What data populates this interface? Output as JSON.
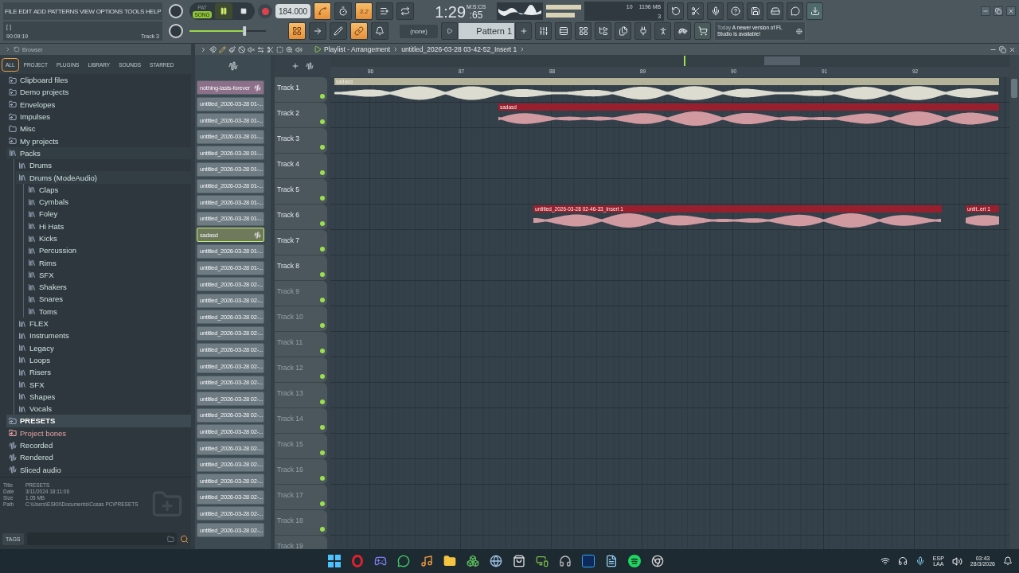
{
  "menu": [
    "FILE",
    "EDIT",
    "ADD",
    "PATTERNS",
    "VIEW",
    "OPTIONS",
    "TOOLS",
    "HELP"
  ],
  "hint": {
    "bracket": "[ ]",
    "time": "90:09:19",
    "track": "Track 3"
  },
  "transport": {
    "modes": [
      {
        "label": "PAT",
        "selected": false
      },
      {
        "label": "SONG",
        "selected": true
      }
    ]
  },
  "tempo": "184.000",
  "master_volume": {
    "level": 0.73
  },
  "time": {
    "main": "1:29",
    "fraction": ":65",
    "unit": "M:S:CS"
  },
  "cpu": {
    "count": "10",
    "memory": "1196 MB",
    "count_2": "3"
  },
  "toggles_top": [
    {
      "kind": "metronome",
      "on": true
    },
    {
      "kind": "wait",
      "on": false
    },
    {
      "kind": "countdown",
      "on": true,
      "label": "3.2"
    },
    {
      "kind": "overdub",
      "on": false
    },
    {
      "kind": "loop",
      "on": false
    }
  ],
  "toggles_bottom": [
    {
      "kind": "step",
      "on": true
    },
    {
      "kind": "arrow",
      "on": false
    },
    {
      "kind": "blend",
      "on": false
    },
    {
      "kind": "link",
      "on": true
    },
    {
      "kind": "bell",
      "on": false
    }
  ],
  "pattern_selector": {
    "value": "(none)",
    "pattern": "Pattern 1"
  },
  "news": {
    "date": "Today",
    "message": "A newer version of FL Studio is available!"
  },
  "browser": {
    "title": "Browser",
    "tabs": [
      {
        "label": "ALL",
        "selected": true
      },
      {
        "label": "PROJECT",
        "selected": false
      },
      {
        "label": "PLUGINS",
        "selected": false
      },
      {
        "label": "LIBRARY",
        "selected": false
      },
      {
        "label": "SOUNDS",
        "selected": false
      },
      {
        "label": "STARRED",
        "selected": false
      }
    ],
    "tree": [
      {
        "label": "Clipboard files",
        "kind": "link_folder",
        "selected": false
      },
      {
        "label": "Demo projects",
        "kind": "link_folder",
        "selected": false
      },
      {
        "label": "Envelopes",
        "kind": "link_folder",
        "selected": false
      },
      {
        "label": "Impulses",
        "kind": "link_folder",
        "selected": false
      },
      {
        "label": "Misc",
        "kind": "folder",
        "selected": false
      },
      {
        "label": "My projects",
        "kind": "link_folder",
        "selected": false
      },
      {
        "label": "Packs",
        "kind": "pack",
        "selected": false,
        "expanded": true,
        "children": [
          {
            "label": "Drums",
            "kind": "pack",
            "selected": false
          },
          {
            "label": "Drums (ModeAudio)",
            "kind": "pack",
            "selected": false,
            "expanded": true,
            "children": [
              {
                "label": "Claps",
                "kind": "pack",
                "selected": false
              },
              {
                "label": "Cymbals",
                "kind": "pack",
                "selected": false
              },
              {
                "label": "Foley",
                "kind": "pack",
                "selected": false
              },
              {
                "label": "Hi Hats",
                "kind": "pack",
                "selected": false
              },
              {
                "label": "Kicks",
                "kind": "pack",
                "selected": false
              },
              {
                "label": "Percussion",
                "kind": "pack",
                "selected": false
              },
              {
                "label": "Rims",
                "kind": "pack",
                "selected": false
              },
              {
                "label": "SFX",
                "kind": "pack",
                "selected": false
              },
              {
                "label": "Shakers",
                "kind": "pack",
                "selected": false
              },
              {
                "label": "Snares",
                "kind": "pack",
                "selected": false
              },
              {
                "label": "Toms",
                "kind": "pack",
                "selected": false
              }
            ]
          },
          {
            "label": "FLEX",
            "kind": "pack",
            "selected": false
          },
          {
            "label": "Instruments",
            "kind": "pack",
            "selected": false
          },
          {
            "label": "Legacy",
            "kind": "pack",
            "selected": false
          },
          {
            "label": "Loops",
            "kind": "pack",
            "selected": false
          },
          {
            "label": "Risers",
            "kind": "pack",
            "selected": false
          },
          {
            "label": "SFX",
            "kind": "pack",
            "selected": false
          },
          {
            "label": "Shapes",
            "kind": "pack",
            "selected": false
          },
          {
            "label": "Vocals",
            "kind": "pack",
            "selected": false
          }
        ]
      },
      {
        "label": "PRESETS",
        "kind": "link_folder",
        "selected": true
      },
      {
        "label": "Project bones",
        "kind": "link_folder",
        "selected": false,
        "color": "#e6a3a3"
      },
      {
        "label": "Recorded",
        "kind": "audio",
        "selected": false
      },
      {
        "label": "Rendered",
        "kind": "audio",
        "selected": false
      },
      {
        "label": "Sliced audio",
        "kind": "audio",
        "selected": false
      }
    ],
    "info": [
      {
        "label": "Title",
        "value": "PRESETS"
      },
      {
        "label": "Date",
        "value": "3/11/2024 18:11:06"
      },
      {
        "label": "Size",
        "value": "1.05 MB"
      },
      {
        "label": "Path",
        "value": "C:\\Users\\ESKII\\Documents\\Cosas PC\\PRESETS"
      }
    ],
    "tags": "TAGS"
  },
  "playlist": {
    "title": "Playlist - Arrangement",
    "clip_name": "untitled_2026-03-28 03-42-52_Insert 1",
    "ruler": [
      "86",
      "87",
      "88",
      "89",
      "90",
      "91",
      "92"
    ],
    "tracks": [
      {
        "name": "Track 1",
        "dimmed": false,
        "on": true,
        "clips": [
          {
            "label": "sadasd",
            "color": "#b4b299"
          }
        ]
      },
      {
        "name": "Track 2",
        "dimmed": false,
        "on": true,
        "clips": [
          {
            "label": "sadasd",
            "color": "#981f2d"
          }
        ]
      },
      {
        "name": "Track 3",
        "dimmed": false,
        "on": true
      },
      {
        "name": "Track 4",
        "dimmed": false,
        "on": true
      },
      {
        "name": "Track 5",
        "dimmed": false,
        "on": true
      },
      {
        "name": "Track 6",
        "dimmed": false,
        "on": true,
        "clips": [
          {
            "label": "untitled_2026-03-28 02-46-33_Insert 1",
            "color": "#981f2d"
          },
          {
            "label": "untit..ert 1",
            "color": "#981f2d"
          }
        ]
      },
      {
        "name": "Track 7",
        "dimmed": false,
        "on": true
      },
      {
        "name": "Track 8",
        "dimmed": false,
        "on": true
      },
      {
        "name": "Track 9",
        "dimmed": true,
        "on": true
      },
      {
        "name": "Track 10",
        "dimmed": true,
        "on": true
      },
      {
        "name": "Track 11",
        "dimmed": true,
        "on": true
      },
      {
        "name": "Track 12",
        "dimmed": true,
        "on": true
      },
      {
        "name": "Track 13",
        "dimmed": true,
        "on": true
      },
      {
        "name": "Track 14",
        "dimmed": true,
        "on": true
      },
      {
        "name": "Track 15",
        "dimmed": true,
        "on": true
      },
      {
        "name": "Track 16",
        "dimmed": true,
        "on": true
      },
      {
        "name": "Track 17",
        "dimmed": true,
        "on": true
      },
      {
        "name": "Track 18",
        "dimmed": true,
        "on": true
      },
      {
        "name": "Track 19",
        "dimmed": true
      }
    ]
  },
  "patterns": [
    {
      "label": "nothing-lasts-forever",
      "kind": "audio",
      "color": "#8c6f88",
      "selected": false
    },
    {
      "label": "untitled_2026-03-28 01-...",
      "kind": "clip",
      "color": "#6e7b83",
      "selected": false
    },
    {
      "label": "untitled_2026-03-28 01-...",
      "kind": "clip",
      "color": "#6e7b83",
      "selected": false
    },
    {
      "label": "untitled_2026-03-28 01-...",
      "kind": "clip",
      "color": "#6e7b83",
      "selected": false
    },
    {
      "label": "untitled_2026-03-28 01-...",
      "kind": "clip",
      "color": "#6e7b83",
      "selected": false
    },
    {
      "label": "untitled_2026-03-28 01-...",
      "kind": "clip",
      "color": "#6e7b83",
      "selected": false
    },
    {
      "label": "untitled_2026-03-28 01-...",
      "kind": "clip",
      "color": "#6e7b83",
      "selected": false
    },
    {
      "label": "untitled_2026-03-28 01-...",
      "kind": "clip",
      "color": "#6e7b83",
      "selected": false
    },
    {
      "label": "untitled_2026-03-28 01-...",
      "kind": "clip",
      "color": "#6e7b83",
      "selected": false
    },
    {
      "label": "sadasd",
      "kind": "audio",
      "color": "#6f7a5c",
      "selected": true
    },
    {
      "label": "untitled_2026-03-28 01-...",
      "kind": "clip",
      "color": "#6e7b83",
      "selected": false
    },
    {
      "label": "untitled_2026-03-28 01-...",
      "kind": "clip",
      "color": "#6e7b83",
      "selected": false
    },
    {
      "label": "untitled_2026-03-28 02-...",
      "kind": "clip",
      "color": "#6e7b83",
      "selected": false
    },
    {
      "label": "untitled_2026-03-28 02-...",
      "kind": "clip",
      "color": "#6e7b83",
      "selected": false
    },
    {
      "label": "untitled_2026-03-28 02-...",
      "kind": "clip",
      "color": "#6e7b83",
      "selected": false
    },
    {
      "label": "untitled_2026-03-28 02-...",
      "kind": "clip",
      "color": "#6e7b83",
      "selected": false
    },
    {
      "label": "untitled_2026-03-28 02-...",
      "kind": "clip",
      "color": "#6e7b83",
      "selected": false
    },
    {
      "label": "untitled_2026-03-28 02-...",
      "kind": "clip",
      "color": "#6e7b83",
      "selected": false
    },
    {
      "label": "untitled_2026-03-28 02-...",
      "kind": "clip",
      "color": "#6e7b83",
      "selected": false
    },
    {
      "label": "untitled_2026-03-28 02-...",
      "kind": "clip",
      "color": "#6e7b83",
      "selected": false
    },
    {
      "label": "untitled_2026-03-28 02-...",
      "kind": "clip",
      "color": "#6e7b83",
      "selected": false
    },
    {
      "label": "untitled_2026-03-28 02-...",
      "kind": "clip",
      "color": "#6e7b83",
      "selected": false
    },
    {
      "label": "untitled_2026-03-28 02-...",
      "kind": "clip",
      "color": "#6e7b83",
      "selected": false
    },
    {
      "label": "untitled_2026-03-28 02-...",
      "kind": "clip",
      "color": "#6e7b83",
      "selected": false
    },
    {
      "label": "untitled_2026-03-28 02-...",
      "kind": "clip",
      "color": "#6e7b83",
      "selected": false
    },
    {
      "label": "untitled_2026-03-28 02-...",
      "kind": "clip",
      "color": "#6e7b83",
      "selected": false
    },
    {
      "label": "untitled_2026-03-28 02-...",
      "kind": "clip",
      "color": "#6e7b83",
      "selected": false
    },
    {
      "label": "untitled_2026-03-28 02-...",
      "kind": "clip",
      "color": "#6e7b83",
      "selected": false
    }
  ],
  "taskbar": {
    "language": "ESP",
    "region": "LAA",
    "time": "03:43",
    "date": "28/3/2026"
  }
}
